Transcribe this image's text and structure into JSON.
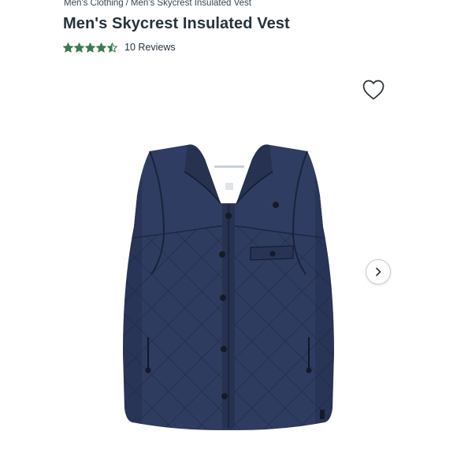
{
  "breadcrumb": {
    "items": [
      "Men's Clothing",
      "Men's Skycrest Insulated Vest"
    ],
    "separator": "/"
  },
  "product": {
    "title": "Men's Skycrest Insulated Vest",
    "rating": 4.5,
    "rating_max": 5,
    "reviews_label": "10 Reviews",
    "image_alt": "Navy quilted insulated vest"
  },
  "icons": {
    "wishlist": "heart-icon",
    "next": "chevron-right-icon"
  },
  "colors": {
    "star": "#3d7a4e",
    "vest": "#2c3a5e",
    "text": "#26323d"
  }
}
